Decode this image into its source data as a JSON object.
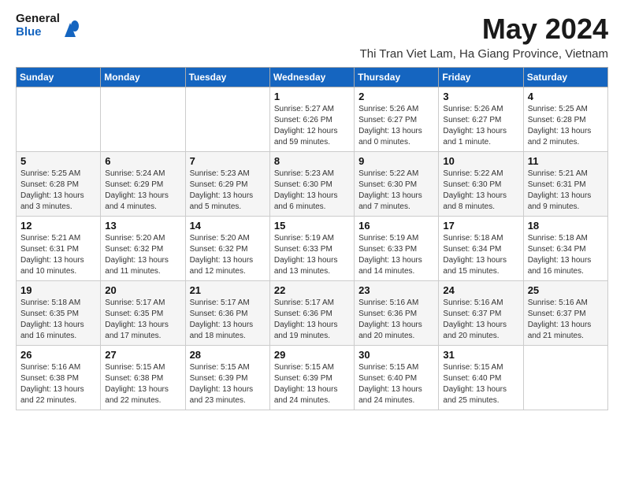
{
  "header": {
    "logo_line1": "General",
    "logo_line2": "Blue",
    "month_year": "May 2024",
    "location": "Thi Tran Viet Lam, Ha Giang Province, Vietnam"
  },
  "weekdays": [
    "Sunday",
    "Monday",
    "Tuesday",
    "Wednesday",
    "Thursday",
    "Friday",
    "Saturday"
  ],
  "weeks": [
    [
      {
        "day": "",
        "info": ""
      },
      {
        "day": "",
        "info": ""
      },
      {
        "day": "",
        "info": ""
      },
      {
        "day": "1",
        "info": "Sunrise: 5:27 AM\nSunset: 6:26 PM\nDaylight: 12 hours\nand 59 minutes."
      },
      {
        "day": "2",
        "info": "Sunrise: 5:26 AM\nSunset: 6:27 PM\nDaylight: 13 hours\nand 0 minutes."
      },
      {
        "day": "3",
        "info": "Sunrise: 5:26 AM\nSunset: 6:27 PM\nDaylight: 13 hours\nand 1 minute."
      },
      {
        "day": "4",
        "info": "Sunrise: 5:25 AM\nSunset: 6:28 PM\nDaylight: 13 hours\nand 2 minutes."
      }
    ],
    [
      {
        "day": "5",
        "info": "Sunrise: 5:25 AM\nSunset: 6:28 PM\nDaylight: 13 hours\nand 3 minutes."
      },
      {
        "day": "6",
        "info": "Sunrise: 5:24 AM\nSunset: 6:29 PM\nDaylight: 13 hours\nand 4 minutes."
      },
      {
        "day": "7",
        "info": "Sunrise: 5:23 AM\nSunset: 6:29 PM\nDaylight: 13 hours\nand 5 minutes."
      },
      {
        "day": "8",
        "info": "Sunrise: 5:23 AM\nSunset: 6:30 PM\nDaylight: 13 hours\nand 6 minutes."
      },
      {
        "day": "9",
        "info": "Sunrise: 5:22 AM\nSunset: 6:30 PM\nDaylight: 13 hours\nand 7 minutes."
      },
      {
        "day": "10",
        "info": "Sunrise: 5:22 AM\nSunset: 6:30 PM\nDaylight: 13 hours\nand 8 minutes."
      },
      {
        "day": "11",
        "info": "Sunrise: 5:21 AM\nSunset: 6:31 PM\nDaylight: 13 hours\nand 9 minutes."
      }
    ],
    [
      {
        "day": "12",
        "info": "Sunrise: 5:21 AM\nSunset: 6:31 PM\nDaylight: 13 hours\nand 10 minutes."
      },
      {
        "day": "13",
        "info": "Sunrise: 5:20 AM\nSunset: 6:32 PM\nDaylight: 13 hours\nand 11 minutes."
      },
      {
        "day": "14",
        "info": "Sunrise: 5:20 AM\nSunset: 6:32 PM\nDaylight: 13 hours\nand 12 minutes."
      },
      {
        "day": "15",
        "info": "Sunrise: 5:19 AM\nSunset: 6:33 PM\nDaylight: 13 hours\nand 13 minutes."
      },
      {
        "day": "16",
        "info": "Sunrise: 5:19 AM\nSunset: 6:33 PM\nDaylight: 13 hours\nand 14 minutes."
      },
      {
        "day": "17",
        "info": "Sunrise: 5:18 AM\nSunset: 6:34 PM\nDaylight: 13 hours\nand 15 minutes."
      },
      {
        "day": "18",
        "info": "Sunrise: 5:18 AM\nSunset: 6:34 PM\nDaylight: 13 hours\nand 16 minutes."
      }
    ],
    [
      {
        "day": "19",
        "info": "Sunrise: 5:18 AM\nSunset: 6:35 PM\nDaylight: 13 hours\nand 16 minutes."
      },
      {
        "day": "20",
        "info": "Sunrise: 5:17 AM\nSunset: 6:35 PM\nDaylight: 13 hours\nand 17 minutes."
      },
      {
        "day": "21",
        "info": "Sunrise: 5:17 AM\nSunset: 6:36 PM\nDaylight: 13 hours\nand 18 minutes."
      },
      {
        "day": "22",
        "info": "Sunrise: 5:17 AM\nSunset: 6:36 PM\nDaylight: 13 hours\nand 19 minutes."
      },
      {
        "day": "23",
        "info": "Sunrise: 5:16 AM\nSunset: 6:36 PM\nDaylight: 13 hours\nand 20 minutes."
      },
      {
        "day": "24",
        "info": "Sunrise: 5:16 AM\nSunset: 6:37 PM\nDaylight: 13 hours\nand 20 minutes."
      },
      {
        "day": "25",
        "info": "Sunrise: 5:16 AM\nSunset: 6:37 PM\nDaylight: 13 hours\nand 21 minutes."
      }
    ],
    [
      {
        "day": "26",
        "info": "Sunrise: 5:16 AM\nSunset: 6:38 PM\nDaylight: 13 hours\nand 22 minutes."
      },
      {
        "day": "27",
        "info": "Sunrise: 5:15 AM\nSunset: 6:38 PM\nDaylight: 13 hours\nand 22 minutes."
      },
      {
        "day": "28",
        "info": "Sunrise: 5:15 AM\nSunset: 6:39 PM\nDaylight: 13 hours\nand 23 minutes."
      },
      {
        "day": "29",
        "info": "Sunrise: 5:15 AM\nSunset: 6:39 PM\nDaylight: 13 hours\nand 24 minutes."
      },
      {
        "day": "30",
        "info": "Sunrise: 5:15 AM\nSunset: 6:40 PM\nDaylight: 13 hours\nand 24 minutes."
      },
      {
        "day": "31",
        "info": "Sunrise: 5:15 AM\nSunset: 6:40 PM\nDaylight: 13 hours\nand 25 minutes."
      },
      {
        "day": "",
        "info": ""
      }
    ]
  ]
}
